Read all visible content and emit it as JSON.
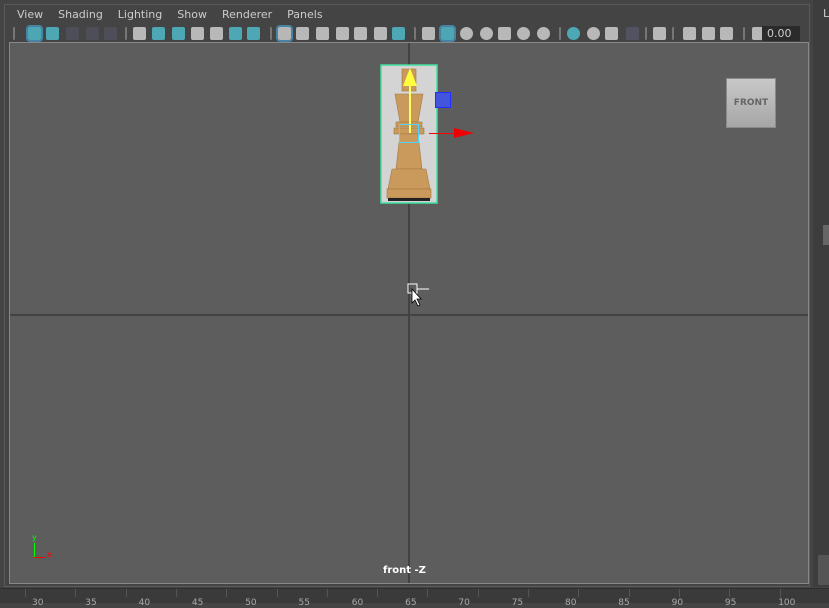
{
  "menu": [
    "View",
    "Shading",
    "Lighting",
    "Show",
    "Renderer",
    "Panels"
  ],
  "toolbar": {
    "icons": [
      "select-camera-icon",
      "camera-attributes-icon",
      "bookmarks-icon",
      "image-plane-icon",
      "2d-pan-icon",
      "camera-icon",
      "lock-camera-icon",
      "camera-sets-icon",
      "bookmark-icon",
      "grease-pencil-icon",
      "zoom-pan-icon",
      "paint-icon",
      "grid-icon",
      "film-gate-icon",
      "resolution-gate-icon",
      "gate-mask-icon",
      "field-chart-icon",
      "safe-action-icon",
      "safe-title-icon",
      "wireframe-icon",
      "smooth-shade-icon",
      "default-material-icon",
      "wireframe-on-shaded-icon",
      "textured-icon",
      "use-all-lights-icon",
      "shadows-icon",
      "screen-space-ao-icon",
      "motion-blur-icon",
      "anti-aliasing-icon",
      "depth-of-field-icon",
      "isolate-select-icon",
      "xray-icon",
      "xray-active-icon",
      "xray-joints-icon",
      "exposure-icon"
    ],
    "exposure_value": "0.00"
  },
  "viewport": {
    "view_cube_label": "FRONT",
    "camera_label": "front -Z",
    "axis_y": "y",
    "axis_x": "x"
  },
  "right_panel": {
    "label": "L"
  },
  "ruler": {
    "labels": [
      "30",
      "35",
      "40",
      "45",
      "50",
      "55",
      "60",
      "65",
      "70",
      "75",
      "80",
      "85",
      "90",
      "95",
      "100"
    ]
  },
  "colors": {
    "accent": "#5bc0d0",
    "selection": "#40e0a0",
    "viewport_bg": "#5d5d5d"
  }
}
